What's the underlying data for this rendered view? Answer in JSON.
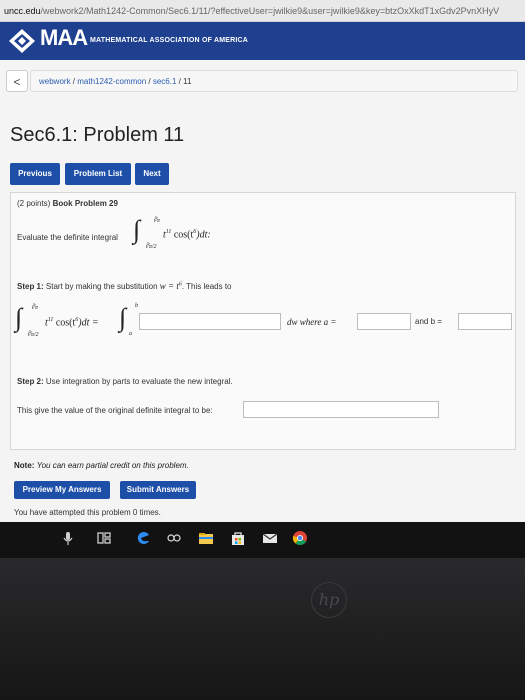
{
  "browser": {
    "url_host": "uncc.edu",
    "url_path": "/webwork2/Math1242-Common/Sec6.1/11/?effectiveUser=jwilkie9&user=jwilkie9&key=btzOxXkdT1xGdv2PvnXHyV"
  },
  "header": {
    "logo_text": "MAA",
    "org_name": "MATHEMATICAL ASSOCIATION OF AMERICA"
  },
  "breadcrumb": {
    "back_label": "<",
    "items": [
      "webwork",
      "math1242-common",
      "sec6.1",
      "11"
    ],
    "separator": " / "
  },
  "page_title": "Sec6.1: Problem 11",
  "nav": {
    "previous": "Previous",
    "problem_list": "Problem List",
    "next": "Next"
  },
  "problem": {
    "points": "(2 points)",
    "book_ref": "Book Problem 29",
    "prompt": "Evaluate the definite integral",
    "integrand": "t",
    "integrand_exp": "11",
    "integrand_cos": "cos(t",
    "integrand_cos_exp": "6",
    "integrand_tail": ")dt:",
    "upper_limit": "∛π",
    "lower_limit": "∛π/2",
    "step1_label": "Step 1:",
    "step1_text": "Start by making the substitution",
    "substitution": "w = t",
    "substitution_exp": "6",
    "step1_tail": ". This leads to",
    "sub_eq_lhs_tail": ")dt =",
    "new_upper": "b",
    "new_lower": "a",
    "dw_where": "dw where a =",
    "and_b": "and b =",
    "step2_label": "Step 2:",
    "step2_text": "Use integration by parts to evaluate the new integral.",
    "final_text": "This give the value of the original definite integral to be:"
  },
  "note": {
    "label": "Note:",
    "text": "You can earn partial credit on this problem."
  },
  "actions": {
    "preview": "Preview My Answers",
    "submit": "Submit Answers"
  },
  "attempts": "You have attempted this problem 0 times.",
  "laptop_logo": "hp",
  "colors": {
    "maa_blue": "#1f3f8f",
    "button_blue": "#1e4fa8"
  }
}
